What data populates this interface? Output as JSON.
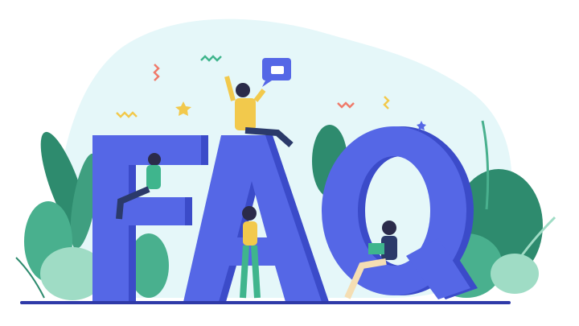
{
  "illustration": {
    "letters": {
      "f": "F",
      "a": "A",
      "q": "Q"
    },
    "colors": {
      "letter_face": "#5567e6",
      "letter_side": "#3b4bc9",
      "background_blob": "#e5f7f9",
      "ground": "#2f3aa8",
      "leaf_dark": "#2e8b6e",
      "leaf_mid": "#49b08e",
      "leaf_light": "#9fdcc5",
      "accent_star": "#f2c94c",
      "accent_squiggle": "#ef7b6b"
    },
    "icons": [
      "thumbs-up-bubble-icon",
      "star-icon",
      "squiggle-icon"
    ]
  }
}
